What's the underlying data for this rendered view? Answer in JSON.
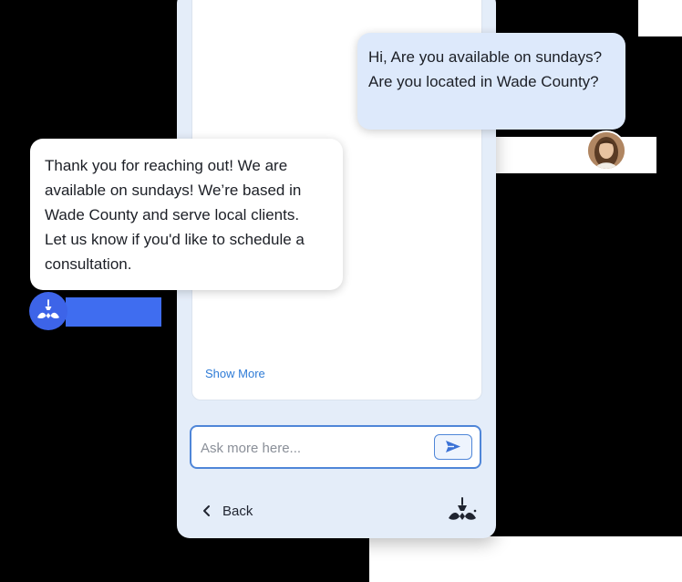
{
  "chat": {
    "user_message": "Hi, Are you available on sundays? Are you located in Wade County?",
    "bot_message": "Thank you for reaching out! We are available on sundays! We’re based in Wade County and serve local clients. Let us know if you'd like to schedule a consultation.",
    "show_more_label": "Show More"
  },
  "composer": {
    "placeholder": "Ask more here...",
    "value": ""
  },
  "footer": {
    "back_label": "Back"
  },
  "icons": {
    "send": "send-icon",
    "back": "chevron-left-icon",
    "brand": "brand-logo",
    "bot_avatar": "bot-avatar-icon",
    "user_avatar": "user-avatar"
  },
  "colors": {
    "accent_blue": "#4f86d8",
    "link_blue": "#2e7bd6",
    "panel_bg": "#e4edf9",
    "user_bubble": "#dde9fb",
    "bot_badge": "#3d64e8"
  }
}
